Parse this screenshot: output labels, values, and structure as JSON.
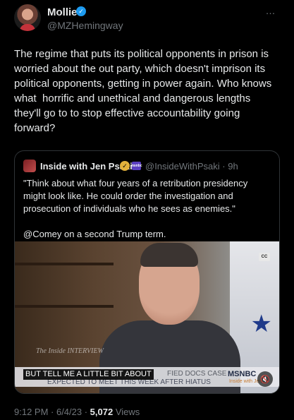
{
  "author": {
    "name": "Mollie",
    "handle": "@MZHemingway"
  },
  "more_icon": "…",
  "tweet_text": "The regime that puts its political opponents in prison is\nworried about the out party, which doesn't imprison its\npolitical opponents, getting in power again. Who knows\nwhat  horrific and unethical and dangerous lengths\nthey'll go to to stop effective accountability going\nforward?",
  "quoted": {
    "name": "Inside with Jen Psaki",
    "handle_time": "@InsideWithPsaki · 9h",
    "network_tag": "msnbc",
    "text": "\"Think about what four years of a retribution presidency\nmight look like. He could order the investigation and\nprosecution of individuals who he sees as enemies.\"\n\n@Comey on a second Trump term.",
    "video": {
      "caption": "BUT TELL ME A LITTLE BIT ABOUT",
      "headline_rest": "FIED DOCS CASE",
      "headline_sub": "EXPECTED TO MEET THIS WEEK AFTER HIATUS",
      "bug": "The Inside INTERVIEW",
      "network": "MSNBC",
      "network_sub": "Inside with Jen",
      "cc_label": "CC"
    }
  },
  "meta": {
    "time_date": "9:12 PM · 6/4/23 · ",
    "views_count": "5,072",
    "views_label": " Views"
  },
  "icons": {
    "verified": "verified-check-icon",
    "gold_check": "gold-verified-icon",
    "more": "more-dots-icon",
    "cc": "closed-captions-icon",
    "mute": "muted-speaker-icon",
    "star": "star-icon"
  },
  "colors": {
    "accent_blue": "#1d9bf0",
    "background": "#000000",
    "secondary_text": "#71767b",
    "gold": "#e2b13c"
  }
}
